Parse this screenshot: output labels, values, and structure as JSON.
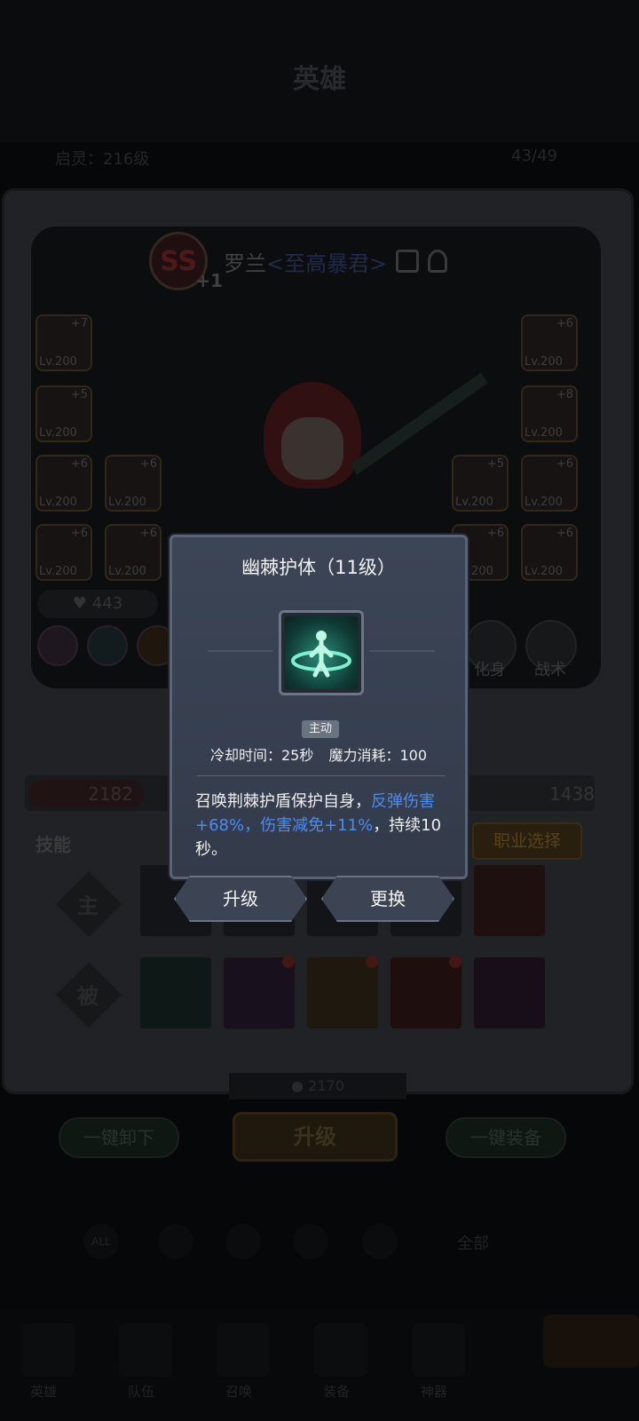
{
  "header": {
    "title": "英雄",
    "level_text": "启灵：216级",
    "count_text": "43/49"
  },
  "hero": {
    "rank": "SS",
    "rank_plus": "+1",
    "name": "罗兰",
    "title": "<至高暴君>"
  },
  "equipment_slots": [
    {
      "plus": "+7",
      "level": "Lv.200"
    },
    {
      "plus": "+5",
      "level": "Lv.200"
    },
    {
      "plus": "+6",
      "level": "Lv.200"
    },
    {
      "plus": "+6",
      "level": "Lv.200"
    },
    {
      "plus": "+6",
      "level": "Lv.200"
    },
    {
      "plus": "+6",
      "level": "Lv.200"
    },
    {
      "plus": "+6",
      "level": "Lv.200"
    },
    {
      "plus": "+8",
      "level": "Lv.200"
    },
    {
      "plus": "+5",
      "level": "Lv.200"
    },
    {
      "plus": "+6",
      "level": "Lv.200"
    },
    {
      "plus": "+6",
      "level": "Lv.200"
    },
    {
      "plus": "+6",
      "level": "Lv.200"
    }
  ],
  "power_value": "443",
  "side_buttons": {
    "transform": "化身",
    "tactics": "战术"
  },
  "stats": {
    "attack": "2182",
    "defense": "1438"
  },
  "skills_section": {
    "label": "技能",
    "job_button": "职业选择",
    "active_label": "主",
    "passive_label": "被"
  },
  "gem_count": "2170",
  "bottom_actions": {
    "unequip_all": "一键卸下",
    "upgrade": "升级",
    "equip_all": "一键装备"
  },
  "filter": {
    "all_badge": "ALL",
    "all_text": "全部"
  },
  "tabs": [
    "英雄",
    "队伍",
    "召唤",
    "装备",
    "神器"
  ],
  "popup": {
    "title": "幽棘护体（11级）",
    "tag": "主动",
    "cooldown": "冷却时间：25秒",
    "mana": "魔力消耗：100",
    "desc_part1": "召唤荆棘护盾保护自身，",
    "desc_hl1": "反弹伤害+68%，伤害减免+11%",
    "desc_part2": "，持续10秒。",
    "upgrade_button": "升级",
    "replace_button": "更换"
  }
}
